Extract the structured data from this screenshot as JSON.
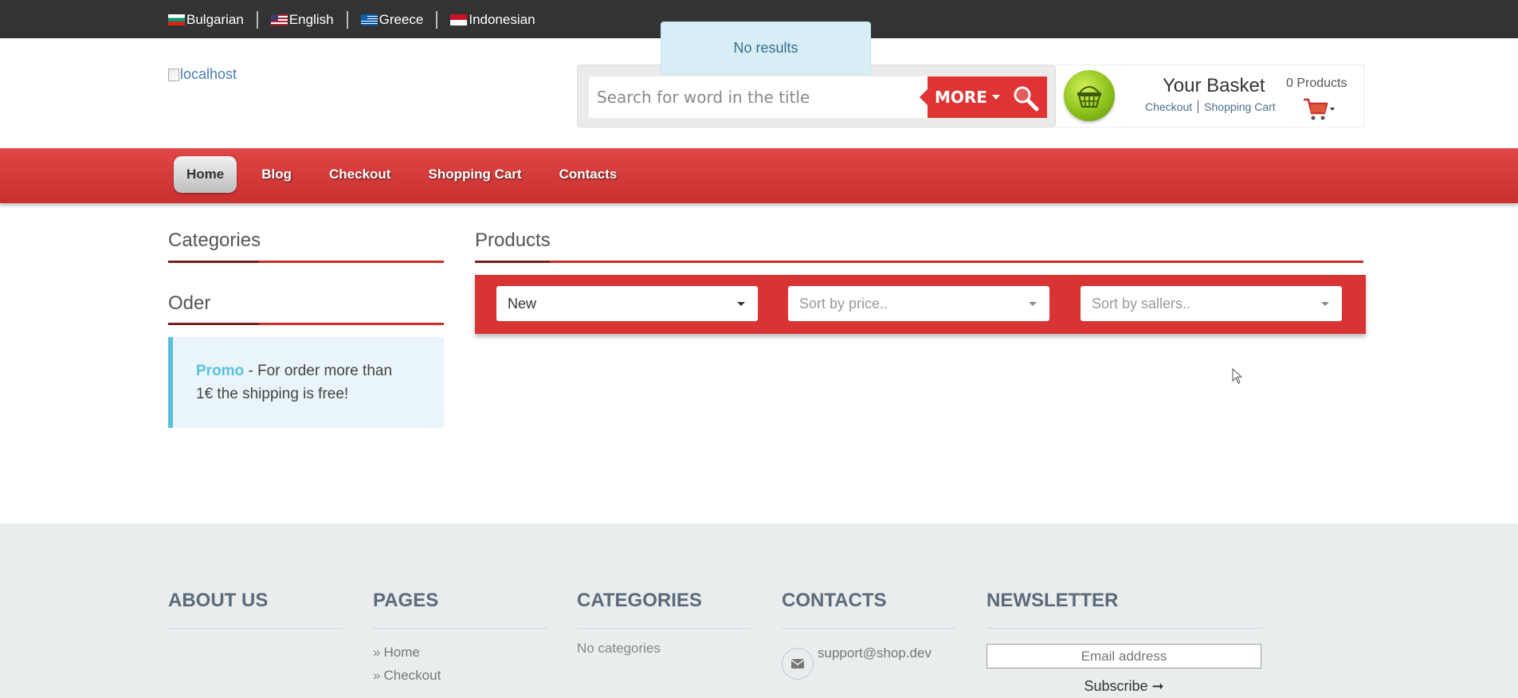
{
  "languages": [
    {
      "label": "Bulgarian",
      "flag": "bulgaria-flag-icon"
    },
    {
      "label": "English",
      "flag": "usa-flag-icon"
    },
    {
      "label": "Greece",
      "flag": "greece-flag-icon"
    },
    {
      "label": "Indonesian",
      "flag": "indonesia-flag-icon"
    }
  ],
  "toast": {
    "message": "No results"
  },
  "logo": {
    "alt_text": "localhost"
  },
  "search": {
    "placeholder": "Search for word in the title",
    "button_label": "MORE",
    "icon": "search-icon"
  },
  "basket": {
    "title": "Your Basket",
    "checkout_link": "Checkout",
    "cart_link": "Shopping Cart",
    "count": "0 Products",
    "icon": "shopping-cart-icon"
  },
  "nav": {
    "items": [
      "Home",
      "Blog",
      "Checkout",
      "Shopping Cart",
      "Contacts"
    ],
    "active": "Home"
  },
  "sidebar": {
    "categories_heading": "Categories",
    "order_heading": "Oder",
    "promo_label": "Promo",
    "promo_text_line1": " - For order more than",
    "promo_text_line2": "1€ the shipping is free!"
  },
  "products": {
    "heading": "Products",
    "filters": [
      {
        "value": "New",
        "placeholder": false
      },
      {
        "value": "Sort by price..",
        "placeholder": true
      },
      {
        "value": "Sort by sallers..",
        "placeholder": true
      }
    ]
  },
  "footer": {
    "about_heading": "ABOUT US",
    "pages_heading": "PAGES",
    "pages_links": [
      "Home",
      "Checkout"
    ],
    "categories_heading": "CATEGORIES",
    "categories_empty": "No categories",
    "contacts_heading": "CONTACTS",
    "contact_email": "support@shop.dev",
    "newsletter_heading": "NEWSLETTER",
    "newsletter_placeholder": "Email address",
    "subscribe_label": "Subscribe ➞"
  },
  "colors": {
    "brand_red": "#e03434",
    "info_blue": "#5bc0de",
    "top_bar": "#333333",
    "footer_bg": "#eaedee"
  }
}
